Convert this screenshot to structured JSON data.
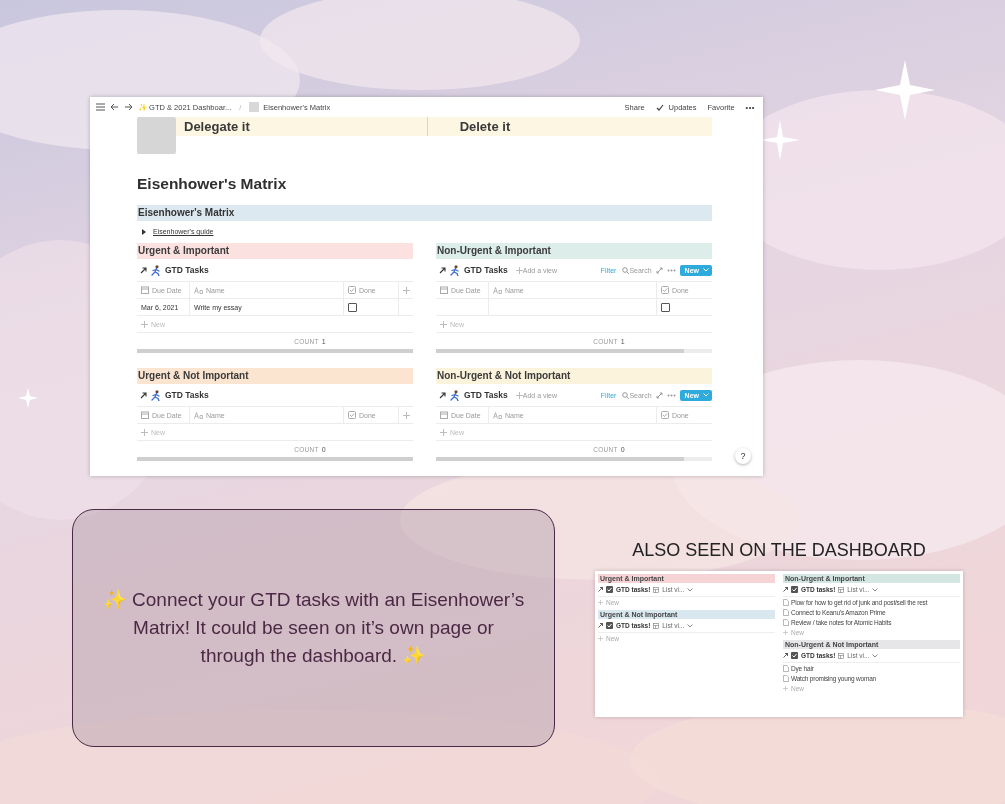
{
  "main_window": {
    "topbar": {
      "breadcrumbs": [
        {
          "label": "✨ GTD & 2021 Dashboar...",
          "kind": "text"
        },
        {
          "separator": "/",
          "label": "Eisenhower's Matrix",
          "kind": "page"
        }
      ],
      "actions": [
        {
          "label": "Share",
          "kind": "text"
        },
        {
          "label": "Updates",
          "kind": "check"
        },
        {
          "label": "Favorite",
          "kind": "text"
        },
        {
          "label": "•••",
          "kind": "more"
        }
      ]
    },
    "banner": [
      "Delegate it",
      "Delete it"
    ],
    "page_title": "Eisenhower's Matrix",
    "callout_heading": "Eisenhower's Matrix",
    "toggle": {
      "label": "Eisenhower's guide",
      "expanded": false
    },
    "quadrants": [
      {
        "title": "Urgent & Important",
        "color": "#fce1e1",
        "view": "GTD Tasks",
        "columns": [
          "Due Date",
          "Name",
          "Done"
        ],
        "add_column": true,
        "rows": [
          {
            "date": "Mar 6, 2021",
            "name": "Write my essay",
            "done": false
          }
        ],
        "new_label": "New",
        "count_label": "COUNT",
        "count": "1"
      },
      {
        "title": "Non-Urgent & Important",
        "color": "#ddedea",
        "view": "GTD Tasks",
        "toolbar": {
          "add_view": "Add a view",
          "filter": "Filter",
          "search": "Search",
          "new": "New"
        },
        "columns": [
          "Due Date",
          "Name",
          "Done"
        ],
        "add_column": false,
        "rows": [
          {
            "done": false
          }
        ],
        "new_label": "New",
        "count_label": "COUNT",
        "count": "1"
      },
      {
        "title": "Urgent & Not Important",
        "color": "#fbe4d0",
        "view": "GTD Tasks",
        "columns": [
          "Due Date",
          "Name",
          "Done"
        ],
        "add_column": true,
        "new_label": "New",
        "count_label": "COUNT",
        "count": "0"
      },
      {
        "title": "Non-Urgent & Not Important",
        "color": "#fbf3db",
        "view": "GTD Tasks",
        "toolbar": {
          "add_view": "Add a view",
          "filter": "Filter",
          "search": "Search",
          "new": "New"
        },
        "columns": [
          "Due Date",
          "Name",
          "Done"
        ],
        "add_column": false,
        "new_label": "New",
        "count_label": "COUNT",
        "count": "0"
      }
    ],
    "help": "?"
  },
  "callout": "✨ Connect your GTD tasks with an Eisenhower’s Matrix! It could be seen on it’s own page or through the dashboard. ✨",
  "dashboard_heading": "ALSO SEEN ON  THE DASHBOARD",
  "dashboard": {
    "columns": [
      [
        {
          "title": "Urgent & Important",
          "color": "#f6d4d6",
          "view": "GTD tasks!",
          "layout": "List vi...",
          "new_label": "New"
        },
        {
          "title": "Urgent & Not Important",
          "color": "#d9e8ee",
          "view": "GTD tasks!",
          "layout": "List vi...",
          "new_label": "New"
        }
      ],
      [
        {
          "title": "Non-Urgent & Important",
          "color": "#d4e6e2",
          "view": "GTD tasks!",
          "layout": "List vi...",
          "items": [
            "Plow for how to get rid of junk and post/sell the rest",
            "Connect to Keanu's Amazon Prime",
            "Review / take notes for Atomic Habits"
          ],
          "new_label": "New"
        },
        {
          "title": "Non-Urgent & Not Important",
          "color": "#e6e5e7",
          "view": "GTD tasks!",
          "layout": "List vi...",
          "items": [
            "Dye hair",
            "Watch promising young woman"
          ],
          "new_label": "New"
        }
      ]
    ]
  }
}
